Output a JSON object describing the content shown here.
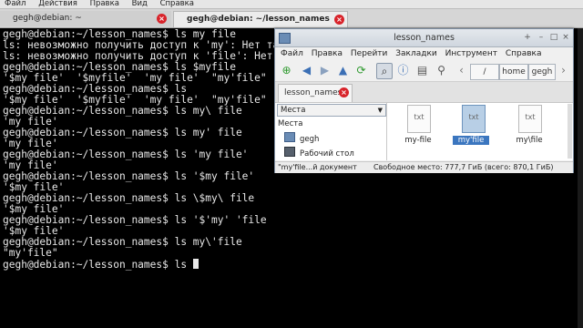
{
  "terminal": {
    "menu": [
      "Файл",
      "Действия",
      "Правка",
      "Вид",
      "Справка"
    ],
    "tabs": [
      {
        "label": "gegh@debian: ~"
      },
      {
        "label": "gegh@debian: ~/lesson_names"
      }
    ],
    "lines": [
      "gegh@debian:~/lesson_names$ ls my file",
      "ls: невозможно получить доступ к 'my': Нет тако",
      "ls: невозможно получить доступ к 'file': Нет та",
      "gegh@debian:~/lesson_names$ ls $myfile",
      "'$my file'  '$myfile'  'my file'  \"my'file\"    m",
      "gegh@debian:~/lesson_names$ ls",
      "'$my file'  '$myfile'  'my file'  \"my'file\"    m",
      "gegh@debian:~/lesson_names$ ls my\\ file",
      "'my file'",
      "gegh@debian:~/lesson_names$ ls my' file",
      "'my file'",
      "gegh@debian:~/lesson_names$ ls 'my file'",
      "'my file'",
      "gegh@debian:~/lesson_names$ ls '$my file'",
      "'$my file'",
      "gegh@debian:~/lesson_names$ ls \\$my\\ file",
      "'$my file'",
      "gegh@debian:~/lesson_names$ ls '$'my' 'file",
      "'$my file'",
      "gegh@debian:~/lesson_names$ ls my\\'file",
      "\"my'file\"",
      "gegh@debian:~/lesson_names$ ls "
    ]
  },
  "file_manager": {
    "title": "lesson_names",
    "menu": [
      "Файл",
      "Правка",
      "Перейти",
      "Закладки",
      "Инструмент",
      "Справка"
    ],
    "breadcrumbs": [
      "/",
      "home",
      "gegh"
    ],
    "tab_label": "lesson_names",
    "sidebar": {
      "selector": "Места",
      "header": "Места",
      "items": [
        "gegh",
        "Рабочий стол"
      ]
    },
    "files": [
      {
        "icon_text": "txt",
        "name": "my-file"
      },
      {
        "icon_text": "txt",
        "name": "my'file"
      },
      {
        "icon_text": "txt",
        "name": "my\\file"
      }
    ],
    "status": {
      "selected": "\"my'file...й документ",
      "free_space": "Свободное место: 777,7 ГиБ (всего: 870,1 ГиБ)"
    }
  },
  "colors": {
    "terminal_bg": "#000000",
    "terminal_fg": "#e8e8e8",
    "tab_close": "#d8232a",
    "selection": "#3b76bf"
  }
}
